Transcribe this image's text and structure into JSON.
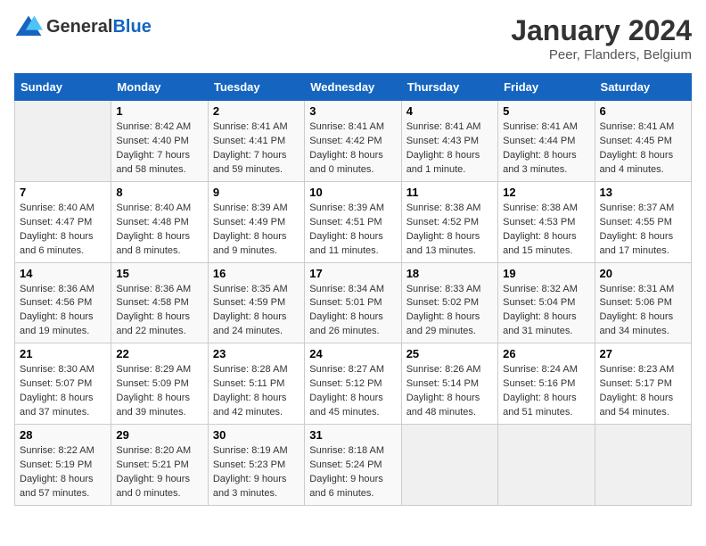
{
  "header": {
    "logo_general": "General",
    "logo_blue": "Blue",
    "title": "January 2024",
    "subtitle": "Peer, Flanders, Belgium"
  },
  "columns": [
    "Sunday",
    "Monday",
    "Tuesday",
    "Wednesday",
    "Thursday",
    "Friday",
    "Saturday"
  ],
  "weeks": [
    [
      {
        "day": "",
        "info": ""
      },
      {
        "day": "1",
        "info": "Sunrise: 8:42 AM\nSunset: 4:40 PM\nDaylight: 7 hours\nand 58 minutes."
      },
      {
        "day": "2",
        "info": "Sunrise: 8:41 AM\nSunset: 4:41 PM\nDaylight: 7 hours\nand 59 minutes."
      },
      {
        "day": "3",
        "info": "Sunrise: 8:41 AM\nSunset: 4:42 PM\nDaylight: 8 hours\nand 0 minutes."
      },
      {
        "day": "4",
        "info": "Sunrise: 8:41 AM\nSunset: 4:43 PM\nDaylight: 8 hours\nand 1 minute."
      },
      {
        "day": "5",
        "info": "Sunrise: 8:41 AM\nSunset: 4:44 PM\nDaylight: 8 hours\nand 3 minutes."
      },
      {
        "day": "6",
        "info": "Sunrise: 8:41 AM\nSunset: 4:45 PM\nDaylight: 8 hours\nand 4 minutes."
      }
    ],
    [
      {
        "day": "7",
        "info": "Sunrise: 8:40 AM\nSunset: 4:47 PM\nDaylight: 8 hours\nand 6 minutes."
      },
      {
        "day": "8",
        "info": "Sunrise: 8:40 AM\nSunset: 4:48 PM\nDaylight: 8 hours\nand 8 minutes."
      },
      {
        "day": "9",
        "info": "Sunrise: 8:39 AM\nSunset: 4:49 PM\nDaylight: 8 hours\nand 9 minutes."
      },
      {
        "day": "10",
        "info": "Sunrise: 8:39 AM\nSunset: 4:51 PM\nDaylight: 8 hours\nand 11 minutes."
      },
      {
        "day": "11",
        "info": "Sunrise: 8:38 AM\nSunset: 4:52 PM\nDaylight: 8 hours\nand 13 minutes."
      },
      {
        "day": "12",
        "info": "Sunrise: 8:38 AM\nSunset: 4:53 PM\nDaylight: 8 hours\nand 15 minutes."
      },
      {
        "day": "13",
        "info": "Sunrise: 8:37 AM\nSunset: 4:55 PM\nDaylight: 8 hours\nand 17 minutes."
      }
    ],
    [
      {
        "day": "14",
        "info": "Sunrise: 8:36 AM\nSunset: 4:56 PM\nDaylight: 8 hours\nand 19 minutes."
      },
      {
        "day": "15",
        "info": "Sunrise: 8:36 AM\nSunset: 4:58 PM\nDaylight: 8 hours\nand 22 minutes."
      },
      {
        "day": "16",
        "info": "Sunrise: 8:35 AM\nSunset: 4:59 PM\nDaylight: 8 hours\nand 24 minutes."
      },
      {
        "day": "17",
        "info": "Sunrise: 8:34 AM\nSunset: 5:01 PM\nDaylight: 8 hours\nand 26 minutes."
      },
      {
        "day": "18",
        "info": "Sunrise: 8:33 AM\nSunset: 5:02 PM\nDaylight: 8 hours\nand 29 minutes."
      },
      {
        "day": "19",
        "info": "Sunrise: 8:32 AM\nSunset: 5:04 PM\nDaylight: 8 hours\nand 31 minutes."
      },
      {
        "day": "20",
        "info": "Sunrise: 8:31 AM\nSunset: 5:06 PM\nDaylight: 8 hours\nand 34 minutes."
      }
    ],
    [
      {
        "day": "21",
        "info": "Sunrise: 8:30 AM\nSunset: 5:07 PM\nDaylight: 8 hours\nand 37 minutes."
      },
      {
        "day": "22",
        "info": "Sunrise: 8:29 AM\nSunset: 5:09 PM\nDaylight: 8 hours\nand 39 minutes."
      },
      {
        "day": "23",
        "info": "Sunrise: 8:28 AM\nSunset: 5:11 PM\nDaylight: 8 hours\nand 42 minutes."
      },
      {
        "day": "24",
        "info": "Sunrise: 8:27 AM\nSunset: 5:12 PM\nDaylight: 8 hours\nand 45 minutes."
      },
      {
        "day": "25",
        "info": "Sunrise: 8:26 AM\nSunset: 5:14 PM\nDaylight: 8 hours\nand 48 minutes."
      },
      {
        "day": "26",
        "info": "Sunrise: 8:24 AM\nSunset: 5:16 PM\nDaylight: 8 hours\nand 51 minutes."
      },
      {
        "day": "27",
        "info": "Sunrise: 8:23 AM\nSunset: 5:17 PM\nDaylight: 8 hours\nand 54 minutes."
      }
    ],
    [
      {
        "day": "28",
        "info": "Sunrise: 8:22 AM\nSunset: 5:19 PM\nDaylight: 8 hours\nand 57 minutes."
      },
      {
        "day": "29",
        "info": "Sunrise: 8:20 AM\nSunset: 5:21 PM\nDaylight: 9 hours\nand 0 minutes."
      },
      {
        "day": "30",
        "info": "Sunrise: 8:19 AM\nSunset: 5:23 PM\nDaylight: 9 hours\nand 3 minutes."
      },
      {
        "day": "31",
        "info": "Sunrise: 8:18 AM\nSunset: 5:24 PM\nDaylight: 9 hours\nand 6 minutes."
      },
      {
        "day": "",
        "info": ""
      },
      {
        "day": "",
        "info": ""
      },
      {
        "day": "",
        "info": ""
      }
    ]
  ]
}
